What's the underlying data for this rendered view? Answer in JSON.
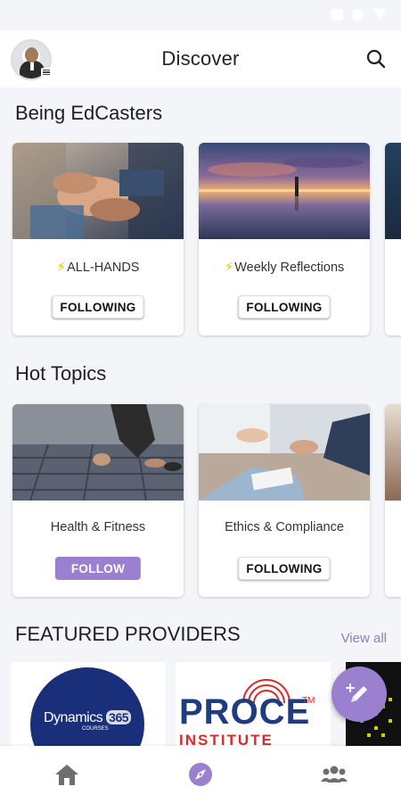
{
  "header": {
    "title": "Discover"
  },
  "sections": {
    "edcasters": {
      "title": "Being EdCasters",
      "cards": [
        {
          "label": "ALL-HANDS",
          "button": "FOLLOWING",
          "has_bolt": true
        },
        {
          "label": "Weekly Reflections",
          "button": "FOLLOWING",
          "has_bolt": true
        }
      ]
    },
    "hot_topics": {
      "title": "Hot Topics",
      "cards": [
        {
          "label": "Health & Fitness",
          "button": "FOLLOW"
        },
        {
          "label": "Ethics & Compliance",
          "button": "FOLLOWING"
        }
      ]
    },
    "providers": {
      "title": "FEATURED PROVIDERS",
      "view_all": "View all",
      "items": [
        {
          "name": "Dynamics 365",
          "logo_main": "Dynamics",
          "logo_sub": "COURSES",
          "logo_num": "365"
        },
        {
          "name": "PROCE INSTITUTE",
          "logo_main": "PROCE",
          "logo_sub": "INSTITUTE",
          "logo_tm": "TM"
        }
      ]
    }
  },
  "bolt_symbol": "⚡",
  "colors": {
    "accent": "#9b80cf",
    "bolt": "#f2c200",
    "view_all": "#8b7fbf"
  },
  "icons": {
    "search": "search-icon",
    "fab": "add-post-icon",
    "nav": [
      "home-icon",
      "compass-icon",
      "groups-icon"
    ]
  }
}
